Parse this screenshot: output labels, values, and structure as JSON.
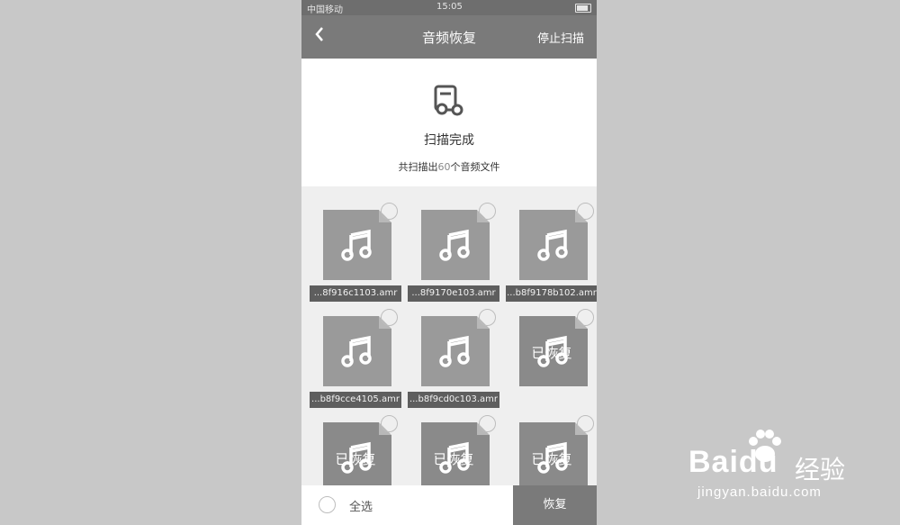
{
  "status_bar": {
    "carrier": "中国移动",
    "time": "15:05"
  },
  "nav": {
    "back_icon": "chevron-left-icon",
    "title": "音频恢复",
    "stop_scan": "停止扫描"
  },
  "header": {
    "icon": "audio-file-icon",
    "status_title": "扫描完成",
    "summary_prefix": "共扫描出",
    "summary_count": "60",
    "summary_suffix": "个音频文件"
  },
  "files": [
    {
      "name": "...8f916c1103.amr",
      "restored": false
    },
    {
      "name": "...8f9170e103.amr",
      "restored": false
    },
    {
      "name": "...b8f9178b102.amr",
      "restored": false
    },
    {
      "name": "...b8f9cce4105.amr",
      "restored": false
    },
    {
      "name": "...b8f9cd0c103.amr",
      "restored": false
    },
    {
      "name": "",
      "restored": true,
      "restored_label": "已恢复"
    },
    {
      "name": "",
      "restored": true,
      "restored_label": "已恢复"
    },
    {
      "name": "",
      "restored": true,
      "restored_label": "已恢复"
    },
    {
      "name": "",
      "restored": true,
      "restored_label": "已恢复"
    }
  ],
  "bottom": {
    "select_all": "全选",
    "restore_button": "恢复"
  },
  "watermark": {
    "brand": "Bai",
    "brand_suffix": "du",
    "product": "经验",
    "url": "jingyan.baidu.com"
  }
}
